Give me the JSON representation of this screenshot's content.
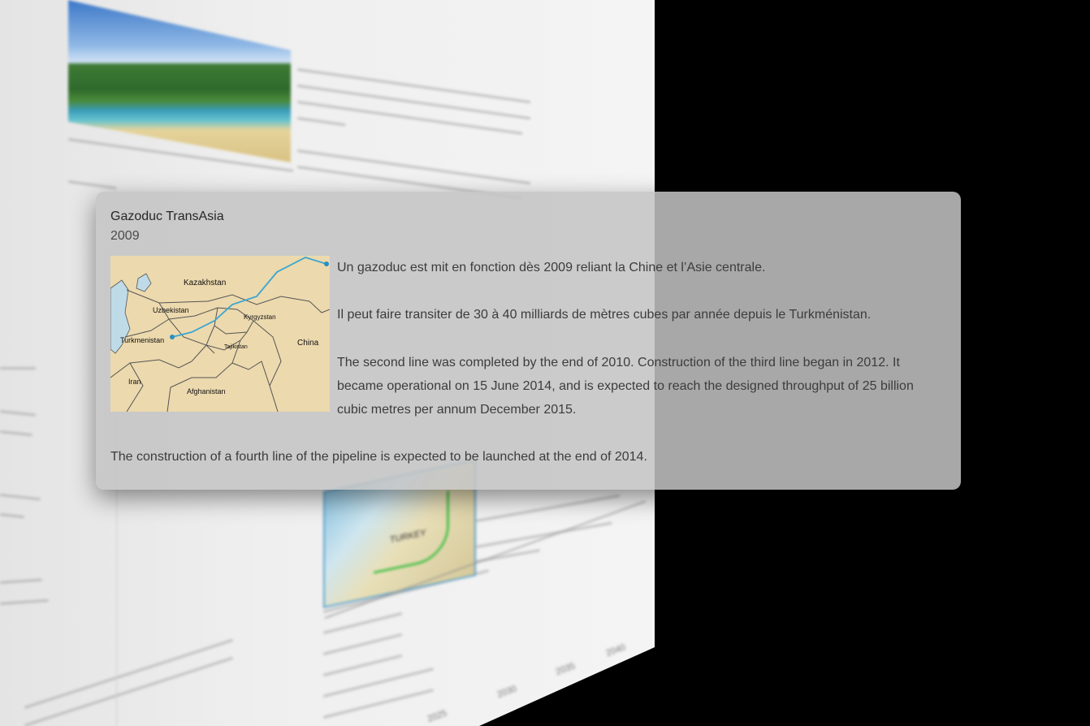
{
  "popup": {
    "title": "Gazoduc TransAsia",
    "year": "2009",
    "paragraphs": [
      "Un gazoduc est mit en fonction dès 2009 reliant la Chine et l’Asie centrale.",
      "Il peut faire transiter de 30 à 40 milliards de mètres cubes par année depuis le Turkménistan.",
      "The second line was completed by the end of 2010. Construction of the third line began in 2012. It became operational on 15 June 2014, and is expected to reach the designed throughput of 25 billion cubic metres per annum December 2015.",
      "The construction of a fourth line of the pipeline is expected to be launched at the end of 2014."
    ],
    "map": {
      "labels": [
        "Kazakhstan",
        "Uzbekistan",
        "Kyrgyzstan",
        "Turkmenistan",
        "Tajikistan",
        "China",
        "Iran",
        "Afghanistan"
      ],
      "colors": {
        "land": "#ecd9ad",
        "borders": "#555555",
        "pipeline": "#3aa6d0"
      }
    }
  },
  "background": {
    "map_label": "TURKEY",
    "years": [
      "2025",
      "2030",
      "2035",
      "2040"
    ]
  }
}
